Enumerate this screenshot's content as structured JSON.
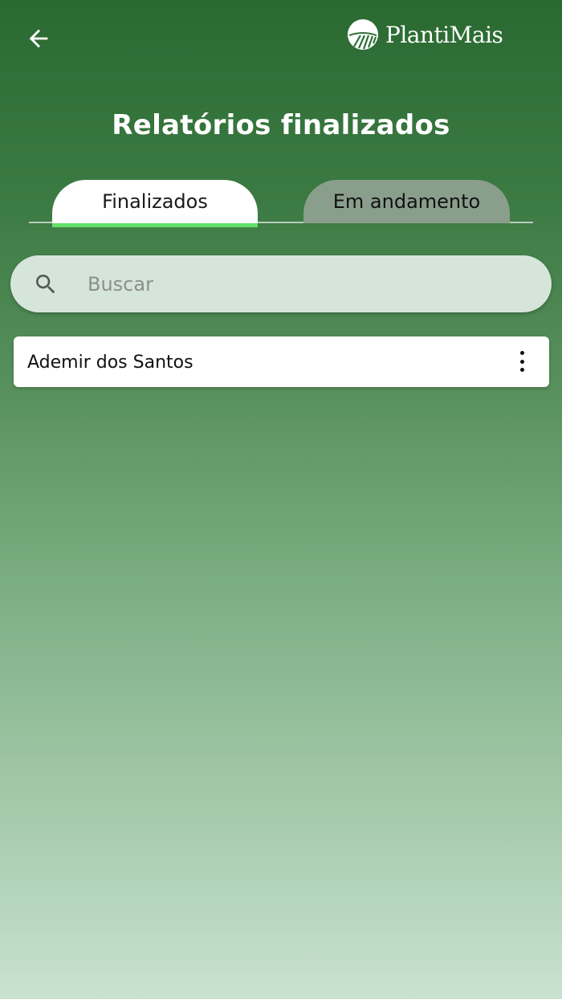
{
  "header": {
    "back_icon": "arrow-left-icon",
    "logo_icon": "plantimais-logo-icon",
    "logo_text": "PlantiMais"
  },
  "page": {
    "title": "Relatórios finalizados"
  },
  "tabs": [
    {
      "label": "Finalizados",
      "active": true
    },
    {
      "label": "Em andamento",
      "active": false
    }
  ],
  "search": {
    "icon": "search-icon",
    "placeholder": "Buscar",
    "value": ""
  },
  "reports": [
    {
      "name": "Ademir dos Santos",
      "menu_icon": "more-vertical-icon"
    }
  ],
  "colors": {
    "active_tab_indicator": "#63e06a",
    "gradient_top": "#2a6a31",
    "gradient_bottom": "#c8e2d0"
  }
}
